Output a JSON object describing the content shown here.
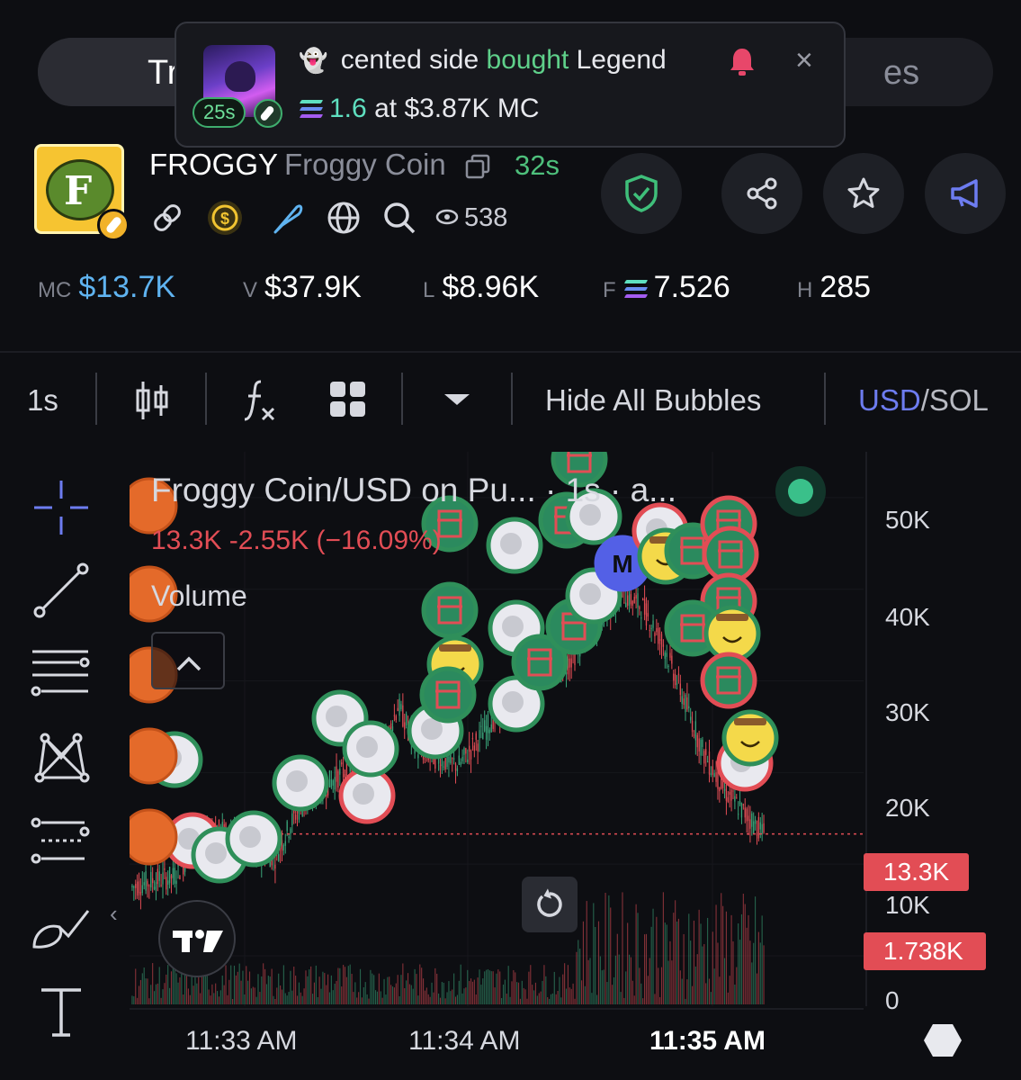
{
  "top_tabs": {
    "left_label": "Tr",
    "right_label": "es"
  },
  "notification": {
    "age": "25s",
    "ghost": "👻",
    "user": "cented side",
    "action": "bought",
    "token": "Legend",
    "amount": "1.6",
    "at_text": "at",
    "market_cap": "$3.87K",
    "mc_suffix": "MC",
    "close": "×"
  },
  "token": {
    "symbol": "FROGGY",
    "name": "Froggy Coin",
    "age": "32s",
    "views": "538",
    "logo_letter": "F"
  },
  "stats": [
    {
      "label": "MC",
      "value": "$13.7K",
      "color": "#5fb3f0"
    },
    {
      "label": "V",
      "value": "$37.9K"
    },
    {
      "label": "L",
      "value": "$8.96K"
    },
    {
      "label": "F",
      "value": "7.526"
    },
    {
      "label": "H",
      "value": "285"
    }
  ],
  "toolbar": {
    "interval": "1s",
    "hide_bubbles": "Hide All Bubbles",
    "currency_active": "USD",
    "currency_sep": "/",
    "currency_other": "SOL"
  },
  "chart_legend": {
    "title": "Froggy Coin/USD on Pu... · 1s · a...",
    "ohlc": "13.3K  -2.55K (−16.09%)",
    "volume": "Volume"
  },
  "chart_data": {
    "type": "candlestick",
    "price_axis": [
      "50K",
      "40K",
      "30K",
      "20K",
      "10K",
      "0"
    ],
    "ylim": [
      0,
      55000
    ],
    "current_price": "13.3K",
    "current_volume": "1.738K",
    "x_ticks": [
      "11:33 AM",
      "11:34 AM",
      "11:35 AM"
    ],
    "close_approx": [
      7500,
      8200,
      8600,
      11500,
      13800,
      13200,
      11500,
      10800,
      15500,
      17800,
      19500,
      21000,
      20200,
      27300,
      22500,
      21500,
      20800,
      23800,
      27000,
      29500,
      32000,
      31000,
      34000,
      37000,
      39500,
      38000,
      34000,
      28000,
      22000,
      18000,
      15500,
      13300
    ]
  },
  "colors": {
    "up": "#3aa57a",
    "down": "#e24d55",
    "accent_blue": "#6d7cf0",
    "background": "#0d0e12"
  }
}
